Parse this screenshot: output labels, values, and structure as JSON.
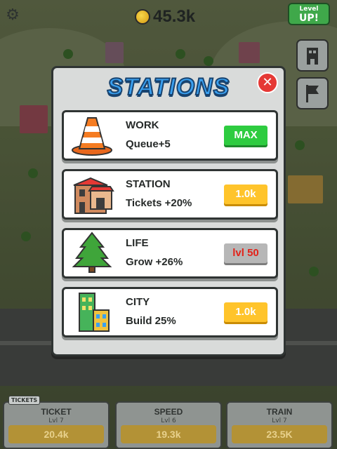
{
  "header": {
    "coins": "45.3k",
    "level_up_small": "Level",
    "level_up_big": "UP!"
  },
  "modal": {
    "title": "STATIONS",
    "rows": [
      {
        "name": "WORK",
        "desc": "Queue+5",
        "button": "MAX",
        "icon": "traffic-cone-icon"
      },
      {
        "name": "STATION",
        "desc": "Tickets +20%",
        "button": "1.0k",
        "icon": "station-building-icon"
      },
      {
        "name": "LIFE",
        "desc": "Grow +26%",
        "button": "lvl 50",
        "icon": "tree-icon"
      },
      {
        "name": "CITY",
        "desc": "Build 25%",
        "button": "1.0k",
        "icon": "city-building-icon"
      }
    ]
  },
  "bottom": {
    "cards": [
      {
        "title": "TICKET",
        "level": "Lvl 7",
        "price": "20.4k",
        "tag": "TICKETS"
      },
      {
        "title": "SPEED",
        "level": "Lvl 6",
        "price": "19.3k"
      },
      {
        "title": "TRAIN",
        "level": "Lvl 7",
        "price": "23.5K"
      }
    ]
  },
  "colors": {
    "max_button": "#2ecc40",
    "buy_button": "#ffc42b",
    "level_locked": "#b7b7b7",
    "close": "#e53935",
    "title_blue": "#3aa0f0"
  }
}
